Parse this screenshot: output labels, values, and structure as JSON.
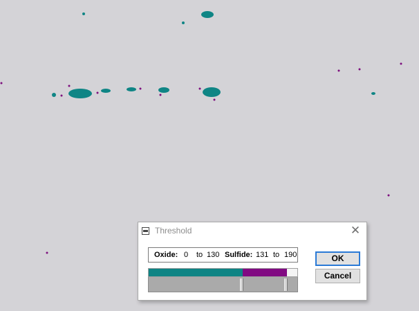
{
  "dialog": {
    "title": "Threshold",
    "system_menu_icon": "window-menu-icon",
    "close_icon": "close-icon",
    "close_glyph": "✕",
    "ranges": {
      "oxide_label": "Oxide:",
      "oxide_min": "0",
      "oxide_to": "to",
      "oxide_max": "130",
      "sulfide_label": "Sulfide:",
      "sulfide_min": "131",
      "sulfide_to": "to",
      "sulfide_max": "190"
    },
    "ok_label": "OK",
    "cancel_label": "Cancel"
  },
  "colors": {
    "oxide": "#0e8484",
    "sulfide": "#810a82",
    "background": "#d4d3d7",
    "ok_focus_border": "#2a7ad6"
  }
}
